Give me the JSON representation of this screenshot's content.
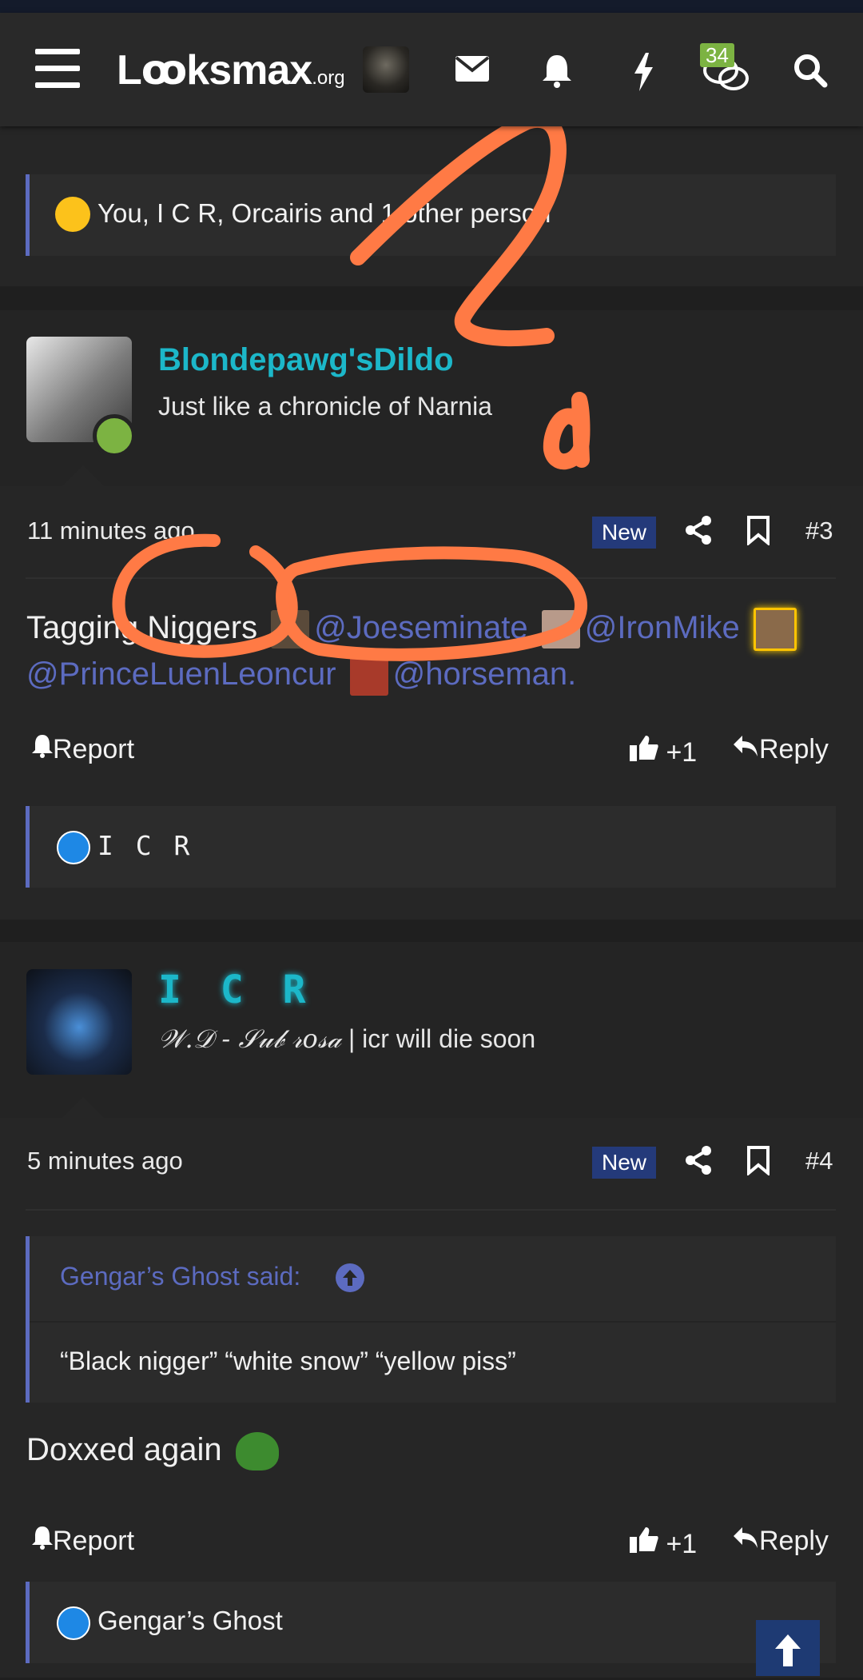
{
  "header": {
    "logo_main": "Lꝏksmax",
    "logo_suffix": ".org",
    "alerts_badge": "34"
  },
  "prev_post": {
    "reactions_text": "You, I C R, Orcairis and 1 other person"
  },
  "post3": {
    "username": "Blondepawg'sDildo",
    "user_title": "Just like a chronicle of Narnia",
    "time": "11 minutes ago",
    "new_label": "New",
    "number": "#3",
    "body_prefix": "Tagging Niggers",
    "mention1": "@Joeseminate",
    "mention2": "@IronMike",
    "mention3": "@PrinceLuenLeoncur",
    "mention4": "@horseman.",
    "report": "Report",
    "like_count": "+1",
    "reply": "Reply",
    "reactions_text": "I C R"
  },
  "post4": {
    "username": "I C R",
    "user_title_script": "𝒲.𝒟 - 𝒮𝓊𝒷 𝓇𝑜𝓈𝒶",
    "user_title_rest": " | icr will die soon",
    "time": "5 minutes ago",
    "new_label": "New",
    "number": "#4",
    "quote_attribution": "Gengar’s Ghost said:",
    "quote_text": "“Black nigger” “white snow” “yellow piss”",
    "body_text": "Doxxed again",
    "report": "Report",
    "like_count": "+1",
    "reply": "Reply",
    "reactions_text": "Gengar’s Ghost"
  },
  "annotation": {
    "handwritten": "2a",
    "color": "#ff7a45"
  }
}
